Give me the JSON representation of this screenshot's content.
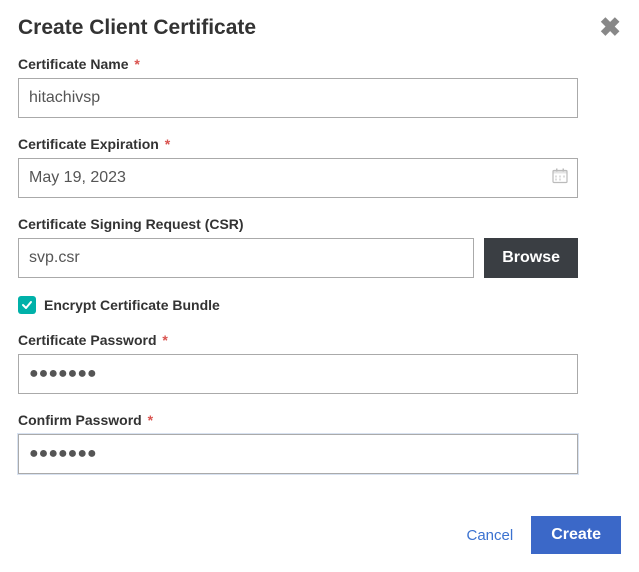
{
  "dialog": {
    "title": "Create Client Certificate",
    "fields": {
      "name": {
        "label": "Certificate Name",
        "required": true,
        "value": "hitachivsp"
      },
      "expiration": {
        "label": "Certificate Expiration",
        "required": true,
        "value": "May 19, 2023"
      },
      "csr": {
        "label": "Certificate Signing Request (CSR)",
        "required": false,
        "value": "svp.csr",
        "browse_label": "Browse"
      },
      "encrypt": {
        "label": "Encrypt Certificate Bundle",
        "checked": true
      },
      "password": {
        "label": "Certificate Password",
        "required": true,
        "value": "●●●●●●●"
      },
      "confirm": {
        "label": "Confirm Password",
        "required": true,
        "value": "●●●●●●●"
      }
    },
    "actions": {
      "cancel": "Cancel",
      "create": "Create"
    }
  }
}
